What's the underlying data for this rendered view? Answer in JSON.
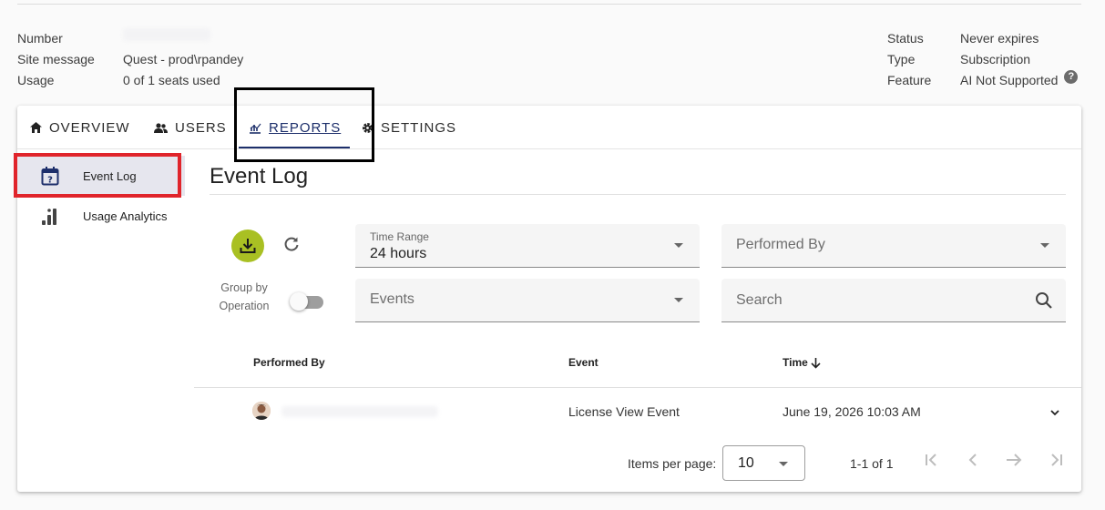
{
  "license_info": {
    "left": [
      {
        "label": "Number",
        "value": ""
      },
      {
        "label": "Site message",
        "value": "Quest - prod\\rpandey"
      },
      {
        "label": "Usage",
        "value": "0 of 1 seats used"
      }
    ],
    "right": [
      {
        "label": "Status",
        "value": "Never expires"
      },
      {
        "label": "Type",
        "value": "Subscription"
      },
      {
        "label": "Feature",
        "value": "AI Not Supported"
      }
    ]
  },
  "tabs": [
    {
      "label": "OVERVIEW",
      "icon": "home-icon"
    },
    {
      "label": "USERS",
      "icon": "users-icon"
    },
    {
      "label": "REPORTS",
      "icon": "reports-icon",
      "active": true
    },
    {
      "label": "SETTINGS",
      "icon": "gear-icon"
    }
  ],
  "sidebar": {
    "items": [
      {
        "label": "Event Log",
        "icon": "calendar-question-icon",
        "active": true
      },
      {
        "label": "Usage Analytics",
        "icon": "bar-chart-icon"
      }
    ]
  },
  "main": {
    "title": "Event Log",
    "group_by_label": "Group by Operation",
    "group_by_enabled": false,
    "filters": {
      "time_range": {
        "label": "Time Range",
        "value": "24 hours"
      },
      "performed_by": {
        "placeholder": "Performed By"
      },
      "events": {
        "placeholder": "Events"
      },
      "search": {
        "placeholder": "Search"
      }
    }
  },
  "table": {
    "columns": [
      "Performed By",
      "Event",
      "Time"
    ],
    "sort_column": "Time",
    "sort_direction": "desc",
    "rows": [
      {
        "performed_by": "",
        "event": "License View Event",
        "time": "June 19, 2026 10:03 AM"
      }
    ]
  },
  "pagination": {
    "items_per_page_label": "Items per page:",
    "items_per_page": "10",
    "range": "1-1 of 1"
  },
  "colors": {
    "accent": "#1d2f6b",
    "download_button": "#a9c023",
    "highlight_red": "#e0242b"
  }
}
